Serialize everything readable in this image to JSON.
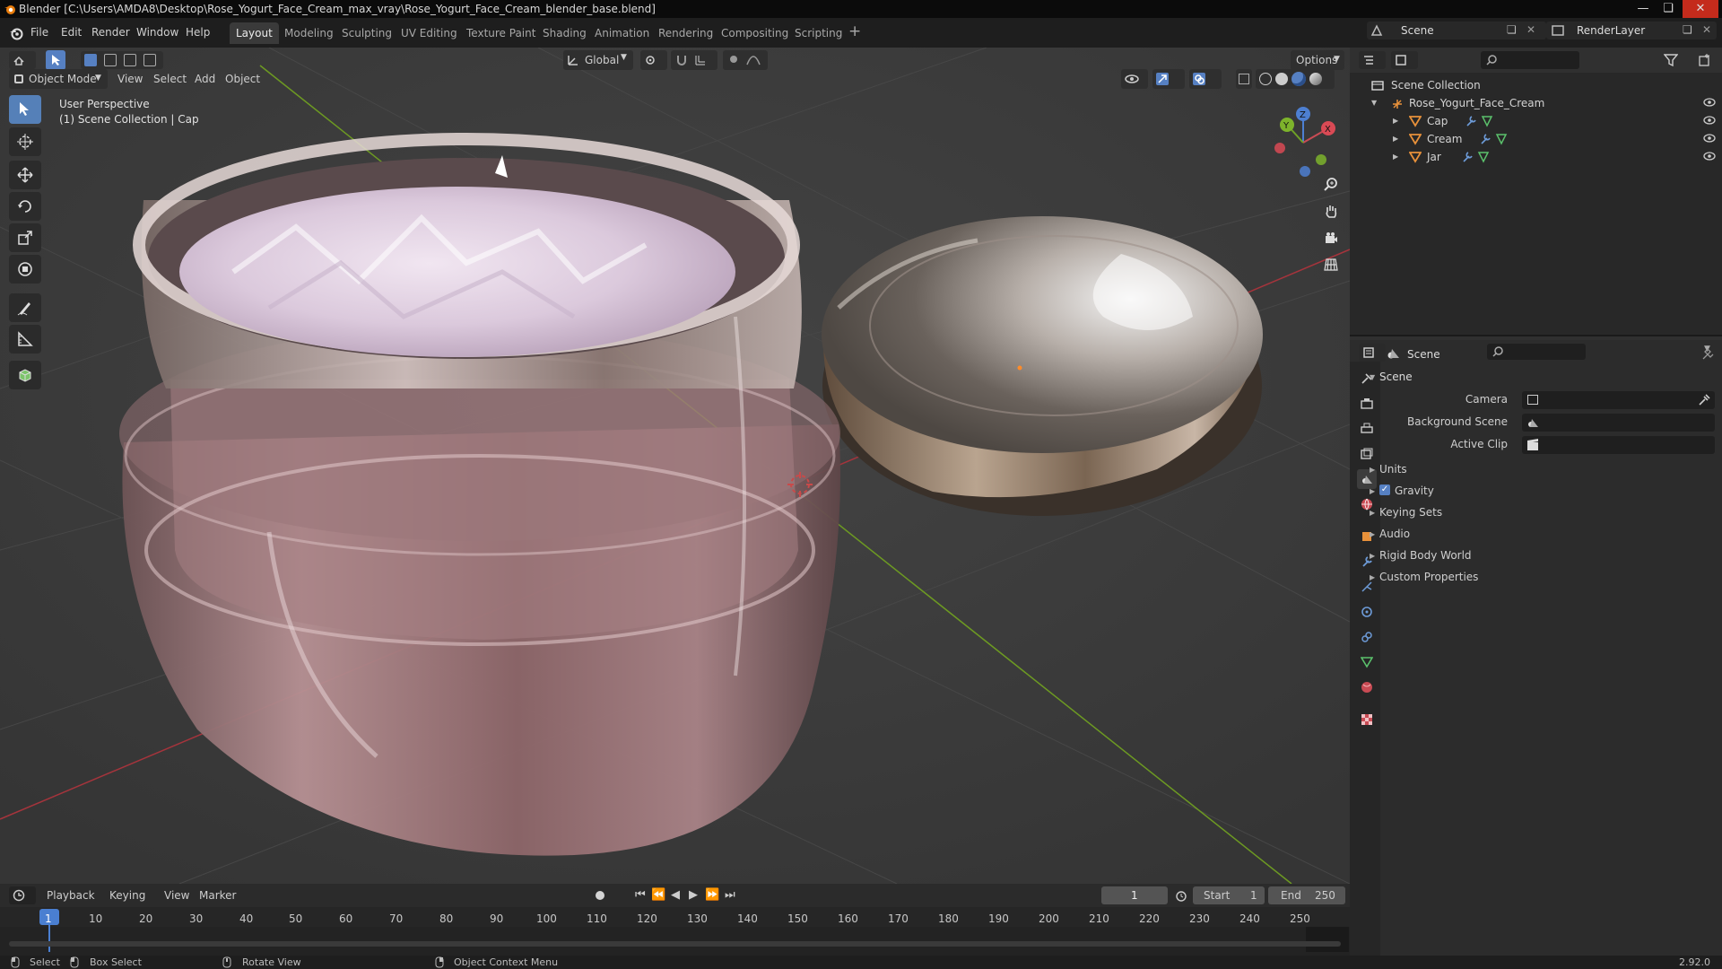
{
  "window": {
    "title": "Blender [C:\\Users\\AMDA8\\Desktop\\Rose_Yogurt_Face_Cream_max_vray\\Rose_Yogurt_Face_Cream_blender_base.blend]"
  },
  "menus": [
    "File",
    "Edit",
    "Render",
    "Window",
    "Help"
  ],
  "workspaces": [
    "Layout",
    "Modeling",
    "Sculpting",
    "UV Editing",
    "Texture Paint",
    "Shading",
    "Animation",
    "Rendering",
    "Compositing",
    "Scripting"
  ],
  "scene_selector": {
    "scene": "Scene",
    "render_layer": "RenderLayer"
  },
  "header": {
    "transform_orientation": "Global",
    "options": "Options"
  },
  "viewport": {
    "mode": "Object Mode",
    "menus": [
      "View",
      "Select",
      "Add",
      "Object"
    ],
    "overlay_line1": "User Perspective",
    "overlay_line2": "(1) Scene Collection | Cap"
  },
  "gizmo": {
    "x": "X",
    "y": "Y",
    "z": "Z"
  },
  "outliner": {
    "root": "Scene Collection",
    "collection": "Rose_Yogurt_Face_Cream",
    "objects": [
      "Cap",
      "Cream",
      "Jar"
    ]
  },
  "properties": {
    "title": "Scene",
    "panel": "Scene",
    "camera_label": "Camera",
    "background_label": "Background Scene",
    "clip_label": "Active Clip",
    "sections": [
      "Units",
      "Gravity",
      "Keying Sets",
      "Audio",
      "Rigid Body World",
      "Custom Properties"
    ],
    "gravity_checked": true
  },
  "timeline": {
    "menus": [
      "Playback",
      "Keying",
      "View",
      "Marker"
    ],
    "current_frame": "1",
    "start_label": "Start",
    "start": "1",
    "end_label": "End",
    "end": "250",
    "ruler": [
      "1",
      "10",
      "20",
      "30",
      "40",
      "50",
      "60",
      "70",
      "80",
      "90",
      "100",
      "110",
      "120",
      "130",
      "140",
      "150",
      "160",
      "170",
      "180",
      "190",
      "200",
      "210",
      "220",
      "230",
      "240",
      "250"
    ]
  },
  "statusbar": {
    "select": "Select",
    "box_select": "Box Select",
    "rotate": "Rotate View",
    "context": "Object Context Menu",
    "version": "2.92.0"
  },
  "colors": {
    "accent": "#4772b3",
    "header": "#303030",
    "viewport": "#3d3d3d",
    "x_axis": "#c7434e",
    "y_axis": "#7aa628"
  }
}
